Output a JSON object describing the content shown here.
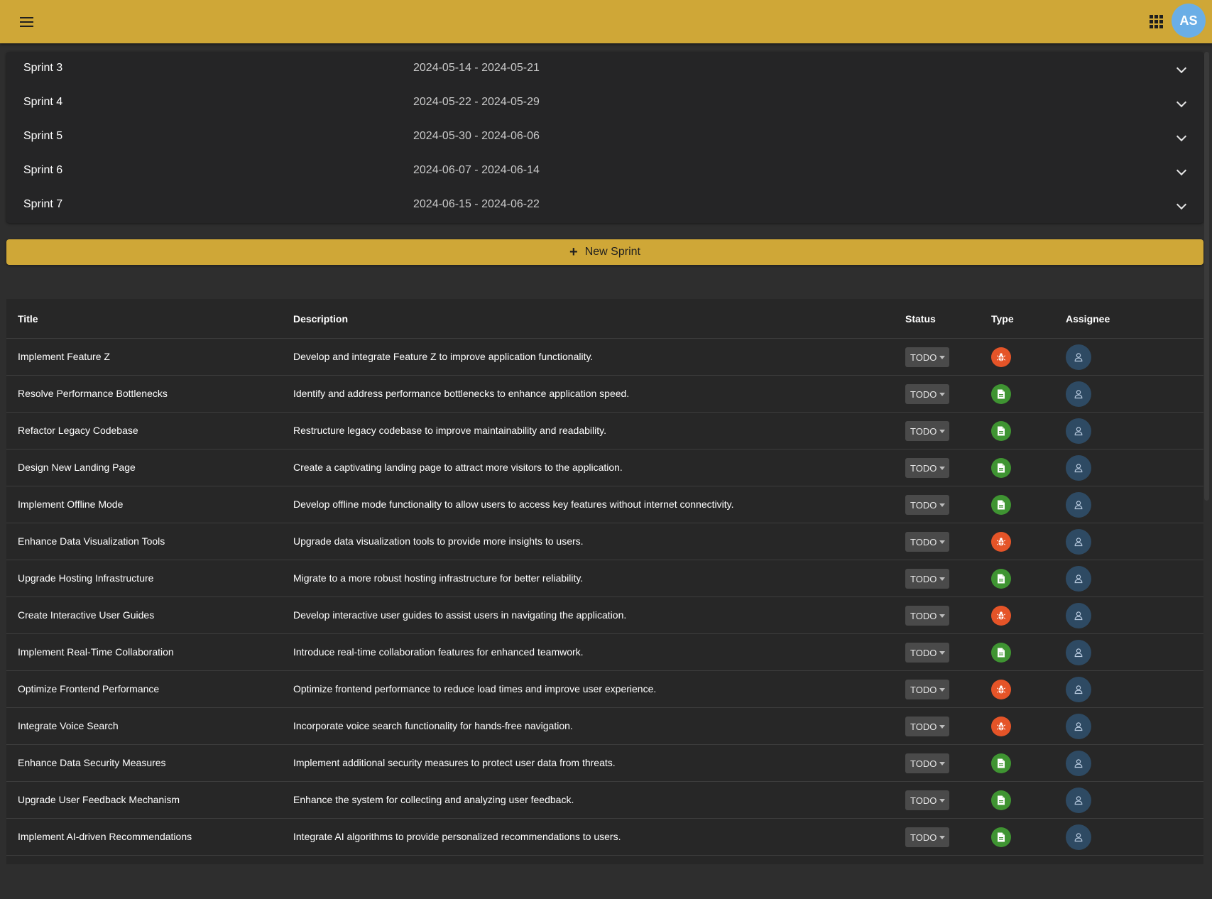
{
  "colors": {
    "accent": "#cfa737",
    "bug": "#e55428",
    "story": "#3f9432",
    "assignee": "#2e4a63",
    "avatar": "#6aaee6"
  },
  "appbar": {
    "menu_icon": "menu-icon",
    "apps_icon": "apps-grid-icon",
    "avatar_initials": "AS"
  },
  "sprints": [
    {
      "name": "Sprint 3",
      "dates": "2024-05-14 - 2024-05-21"
    },
    {
      "name": "Sprint 4",
      "dates": "2024-05-22 - 2024-05-29"
    },
    {
      "name": "Sprint 5",
      "dates": "2024-05-30 - 2024-06-06"
    },
    {
      "name": "Sprint 6",
      "dates": "2024-06-07 - 2024-06-14"
    },
    {
      "name": "Sprint 7",
      "dates": "2024-06-15 - 2024-06-22"
    }
  ],
  "new_sprint": {
    "label": "New Sprint"
  },
  "table": {
    "headers": {
      "title": "Title",
      "description": "Description",
      "status": "Status",
      "type": "Type",
      "assignee": "Assignee"
    },
    "rows": [
      {
        "title": "Implement Feature Z",
        "description": "Develop and integrate Feature Z to improve application functionality.",
        "status": "TODO",
        "type": "bug"
      },
      {
        "title": "Resolve Performance Bottlenecks",
        "description": "Identify and address performance bottlenecks to enhance application speed.",
        "status": "TODO",
        "type": "story"
      },
      {
        "title": "Refactor Legacy Codebase",
        "description": "Restructure legacy codebase to improve maintainability and readability.",
        "status": "TODO",
        "type": "story"
      },
      {
        "title": "Design New Landing Page",
        "description": "Create a captivating landing page to attract more visitors to the application.",
        "status": "TODO",
        "type": "story"
      },
      {
        "title": "Implement Offline Mode",
        "description": "Develop offline mode functionality to allow users to access key features without internet connectivity.",
        "status": "TODO",
        "type": "story"
      },
      {
        "title": "Enhance Data Visualization Tools",
        "description": "Upgrade data visualization tools to provide more insights to users.",
        "status": "TODO",
        "type": "bug"
      },
      {
        "title": "Upgrade Hosting Infrastructure",
        "description": "Migrate to a more robust hosting infrastructure for better reliability.",
        "status": "TODO",
        "type": "story"
      },
      {
        "title": "Create Interactive User Guides",
        "description": "Develop interactive user guides to assist users in navigating the application.",
        "status": "TODO",
        "type": "bug"
      },
      {
        "title": "Implement Real-Time Collaboration",
        "description": "Introduce real-time collaboration features for enhanced teamwork.",
        "status": "TODO",
        "type": "story"
      },
      {
        "title": "Optimize Frontend Performance",
        "description": "Optimize frontend performance to reduce load times and improve user experience.",
        "status": "TODO",
        "type": "bug"
      },
      {
        "title": "Integrate Voice Search",
        "description": "Incorporate voice search functionality for hands-free navigation.",
        "status": "TODO",
        "type": "bug"
      },
      {
        "title": "Enhance Data Security Measures",
        "description": "Implement additional security measures to protect user data from threats.",
        "status": "TODO",
        "type": "story"
      },
      {
        "title": "Upgrade User Feedback Mechanism",
        "description": "Enhance the system for collecting and analyzing user feedback.",
        "status": "TODO",
        "type": "story"
      },
      {
        "title": "Implement AI-driven Recommendations",
        "description": "Integrate AI algorithms to provide personalized recommendations to users.",
        "status": "TODO",
        "type": "story"
      }
    ]
  }
}
